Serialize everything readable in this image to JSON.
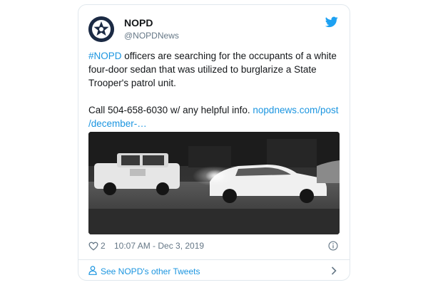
{
  "tweet": {
    "author_name": "NOPD",
    "author_handle": "@NOPDNews",
    "hashtag": "#NOPD",
    "body_line1_rest": " officers are searching for the occupants of a white",
    "body_line2": "four-door sedan that was utilized to burglarize a State",
    "body_line3": "Trooper's patrol unit.",
    "body_call": "Call 504-658-6030 w/ any helpful info. ",
    "link_line1": "nopdnews.com/post",
    "link_line2": "/december-…",
    "likes": "2",
    "timestamp": "10:07 AM - Dec 3, 2019"
  },
  "footer": {
    "see_more": "See NOPD's other Tweets"
  },
  "icons": {
    "avatar": "nopd-star-badge",
    "brand": "twitter-bird-icon",
    "like": "heart-icon",
    "info": "info-icon",
    "person": "person-icon",
    "chevron": "chevron-right-icon"
  },
  "colors": {
    "link": "#1b95e0",
    "text": "#14171a",
    "muted": "#657786",
    "border": "#e1e8ed"
  }
}
